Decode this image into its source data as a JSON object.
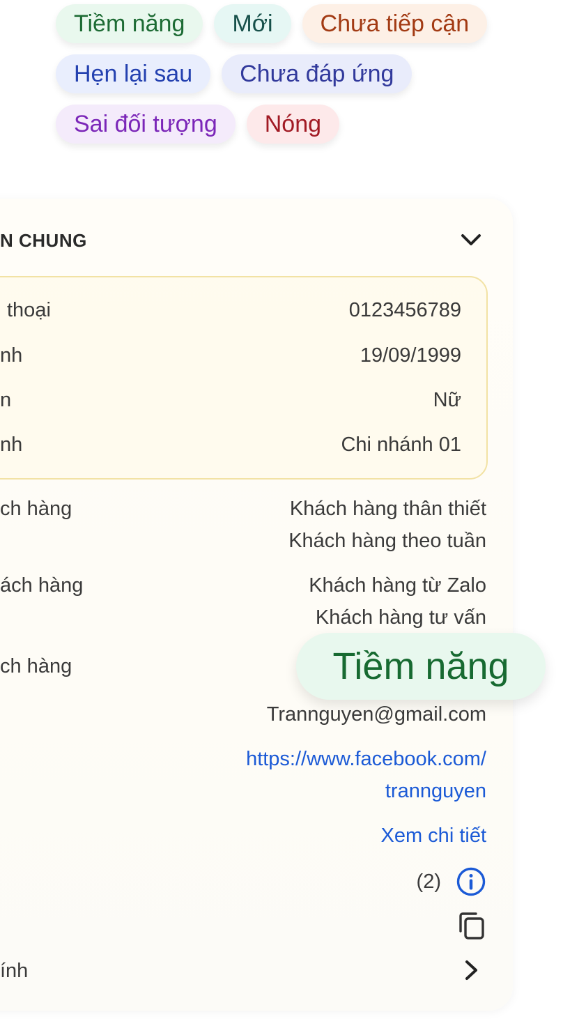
{
  "tags": {
    "row1": [
      "Tiềm năng",
      "Mới",
      "Chưa tiếp cận"
    ],
    "row2": [
      "Hẹn lại sau",
      "Chưa đáp ứng"
    ],
    "row3": [
      "Sai đối tượng",
      "Nóng"
    ]
  },
  "card": {
    "title": "N CHUNG",
    "collapse_icon": "chevron-down-icon",
    "info_box": {
      "phone_label": "thoại",
      "phone_value": "0123456789",
      "dob_label": "nh",
      "dob_value": "19/09/1999",
      "gender_label": "n",
      "gender_value": "Nữ",
      "branch_label": "nh",
      "branch_value": "Chi nhánh 01"
    },
    "customer_group_label": "ch hàng",
    "customer_group_values": [
      "Khách hàng thân thiết",
      "Khách hàng theo tuần"
    ],
    "customer_source_label": "ách hàng",
    "customer_source_values": [
      "Khách hàng từ Zalo",
      "Khách hàng tư vấn"
    ],
    "customer_status_label": "ch hàng",
    "status_tooltip": "Tiềm năng",
    "email_value": "Trannguyen@gmail.com",
    "facebook_lines": [
      "https://www.facebook.com/",
      "trannguyen"
    ],
    "view_detail_link": "Xem chi tiết",
    "count_text": "(2)",
    "info_icon": "info-icon",
    "copy_icon": "copy-icon",
    "last_row_label": "ính",
    "last_row_icon": "chevron-right-icon"
  }
}
